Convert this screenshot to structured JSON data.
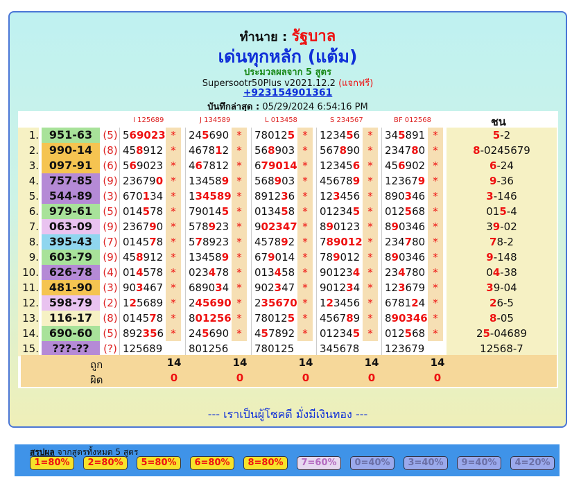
{
  "header": {
    "title_prefix": "ทำนาย :",
    "title_name": "รัฐบาล",
    "subtitle": "เด่นทุกหลัก (แต้ม)",
    "calc_text": "ประมวลผลจาก 5 สูตร",
    "version": "Supersootr50Plus v2021.12.2",
    "version_note": "(แจกฟรี)",
    "phone": "+923154901361",
    "saved_label": "บันทึกล่าสุด :",
    "saved_value": "05/29/2024 6:54:16 PM"
  },
  "columns": {
    "formula_headers": [
      "I 125689",
      "J 134589",
      "L 013458",
      "S 234567",
      "BF 012568"
    ],
    "chon_header": "ชน"
  },
  "rows": [
    {
      "idx": "1.",
      "code": "951-63",
      "bg": "#a8e29a",
      "count": "(5)",
      "nums": [
        [
          "5",
          "69023"
        ],
        [
          "24",
          "5",
          "690"
        ],
        [
          "78012",
          "5"
        ],
        [
          "1234",
          "5",
          "6"
        ],
        [
          "34",
          "5",
          "891"
        ]
      ],
      "chon": [
        [
          "5",
          true
        ],
        [
          "-2",
          false
        ]
      ]
    },
    {
      "idx": "2.",
      "code": "990-14",
      "bg": "#f5c451",
      "count": "(8)",
      "nums": [
        [
          "45",
          "8",
          "912"
        ],
        [
          "4678",
          "1",
          "2"
        ],
        [
          "56",
          "8",
          "903"
        ],
        [
          "567",
          "8",
          "90"
        ],
        [
          "2347",
          "8",
          "0"
        ]
      ],
      "chon": [
        [
          "8",
          true
        ],
        [
          "-0245679",
          false
        ]
      ]
    },
    {
      "idx": "3.",
      "code": "097-91",
      "bg": "#f5c451",
      "count": "(6)",
      "nums": [
        [
          "5",
          "6",
          "9023"
        ],
        [
          "4",
          "6",
          "7812"
        ],
        [
          "6",
          "79014"
        ],
        [
          "12345",
          "6"
        ],
        [
          "45",
          "6",
          "902"
        ]
      ],
      "chon": [
        [
          "6",
          true
        ],
        [
          "-24",
          false
        ]
      ]
    },
    {
      "idx": "4.",
      "code": "757-85",
      "bg": "#b58ad6",
      "count": "(9)",
      "nums": [
        [
          "23679",
          "0"
        ],
        [
          "13458",
          "9"
        ],
        [
          "568",
          "9",
          "03"
        ],
        [
          "45678",
          "9"
        ],
        [
          "12367",
          "9"
        ]
      ],
      "chon": [
        [
          "9",
          true
        ],
        [
          "-36",
          false
        ]
      ]
    },
    {
      "idx": "5.",
      "code": "544-89",
      "bg": "#b58ad6",
      "count": "(3)",
      "nums": [
        [
          "670",
          "1",
          "34"
        ],
        [
          "1",
          "34589"
        ],
        [
          "8912",
          "3",
          "6"
        ],
        [
          "12",
          "3",
          "456"
        ],
        [
          "890",
          "3",
          "46"
        ]
      ],
      "chon": [
        [
          "3",
          true
        ],
        [
          "-146",
          false
        ]
      ]
    },
    {
      "idx": "6.",
      "code": "979-61",
      "bg": "#a8e29a",
      "count": "(5)",
      "nums": [
        [
          "014",
          "5",
          "78"
        ],
        [
          "79014",
          "5"
        ],
        [
          "0134",
          "5",
          "8"
        ],
        [
          "01234",
          "5"
        ],
        [
          "012",
          "5",
          "68"
        ]
      ],
      "chon": [
        [
          "01",
          false
        ],
        [
          "5",
          true
        ],
        [
          "-4",
          false
        ]
      ]
    },
    {
      "idx": "7.",
      "code": "063-09",
      "bg": "#e9c3f0",
      "count": "(9)",
      "nums": [
        [
          "2367",
          "9",
          "0"
        ],
        [
          "578",
          "9",
          "23"
        ],
        [
          "9",
          "02347"
        ],
        [
          "8",
          "9",
          "0123"
        ],
        [
          "8",
          "9",
          "0346"
        ]
      ],
      "chon": [
        [
          "3",
          false
        ],
        [
          "9",
          true
        ],
        [
          "-02",
          false
        ]
      ]
    },
    {
      "idx": "8.",
      "code": "395-43",
      "bg": "#8fd6ef",
      "count": "(7)",
      "nums": [
        [
          "0145",
          "7",
          "8"
        ],
        [
          "5",
          "7",
          "8923"
        ],
        [
          "4578",
          "9",
          "2"
        ],
        [
          "7",
          "89012"
        ],
        [
          "234",
          "7",
          "80"
        ]
      ],
      "chon": [
        [
          "7",
          true
        ],
        [
          "8-2",
          false
        ]
      ]
    },
    {
      "idx": "9.",
      "code": "603-79",
      "bg": "#a8e29a",
      "count": "(9)",
      "nums": [
        [
          "45",
          "8",
          "912"
        ],
        [
          "13458",
          "9"
        ],
        [
          "67",
          "9",
          "014"
        ],
        [
          "78",
          "9",
          "012"
        ],
        [
          "8",
          "9",
          "0346"
        ]
      ],
      "chon": [
        [
          "9",
          true
        ],
        [
          "-148",
          false
        ]
      ]
    },
    {
      "idx": "10.",
      "code": "626-78",
      "bg": "#b58ad6",
      "count": "(4)",
      "nums": [
        [
          "01",
          "4",
          "578"
        ],
        [
          "023",
          "4",
          "78"
        ],
        [
          "013",
          "4",
          "58"
        ],
        [
          "90123",
          "4"
        ],
        [
          "23",
          "4",
          "780"
        ]
      ],
      "chon": [
        [
          "0",
          false
        ],
        [
          "4",
          true
        ],
        [
          "-38",
          false
        ]
      ]
    },
    {
      "idx": "11.",
      "code": "481-90",
      "bg": "#f5c451",
      "count": "(3)",
      "nums": [
        [
          "90",
          "3",
          "467"
        ],
        [
          "6890",
          "3",
          "4"
        ],
        [
          "902",
          "3",
          "47"
        ],
        [
          "9012",
          "3",
          "4"
        ],
        [
          "12",
          "3",
          "679"
        ]
      ],
      "chon": [
        [
          "3",
          true
        ],
        [
          "9-04",
          false
        ]
      ]
    },
    {
      "idx": "12.",
      "code": "598-79",
      "bg": "#e9c3f0",
      "count": "(2)",
      "nums": [
        [
          "1",
          "2",
          "5689"
        ],
        [
          "2",
          "45690"
        ],
        [
          "2",
          "35670"
        ],
        [
          "1",
          "2",
          "3456"
        ],
        [
          "6781",
          "2",
          "4"
        ]
      ],
      "chon": [
        [
          "2",
          true
        ],
        [
          "6-5",
          false
        ]
      ]
    },
    {
      "idx": "13.",
      "code": "116-17",
      "bg": "#f6f1c4",
      "count": "(8)",
      "nums": [
        [
          "0145",
          "7",
          "8"
        ],
        [
          "8",
          "01256"
        ],
        [
          "78012",
          "5"
        ],
        [
          "4567",
          "8",
          "9"
        ],
        [
          "8",
          "90346"
        ]
      ],
      "chon": [
        [
          "8",
          true
        ],
        [
          "-05",
          false
        ]
      ]
    },
    {
      "idx": "14.",
      "code": "690-60",
      "bg": "#a8e29a",
      "count": "(5)",
      "nums": [
        [
          "892",
          "35",
          "6"
        ],
        [
          "24",
          "5",
          "690"
        ],
        [
          "4",
          "5",
          "7892"
        ],
        [
          "01234",
          "5"
        ],
        [
          "012",
          "5",
          "68"
        ]
      ],
      "chon": [
        [
          "2",
          false
        ],
        [
          "5",
          true
        ],
        [
          "-04689",
          false
        ]
      ]
    },
    {
      "idx": "15.",
      "code": "???-??",
      "bg": "#b58ad6",
      "count": "(?)",
      "nums": [
        [
          "125689"
        ],
        [
          "801256"
        ],
        [
          "780125"
        ],
        [
          "345678"
        ],
        [
          "123679"
        ]
      ],
      "chon": [
        [
          "12568-7",
          false
        ]
      ]
    }
  ],
  "summary_row": {
    "hit_label": "ถูก",
    "miss_label": "ผิด",
    "hits": [
      "14",
      "14",
      "14",
      "14",
      "14"
    ],
    "misses": [
      "0",
      "0",
      "0",
      "0",
      "0"
    ]
  },
  "footer": {
    "message": "--- เราเป็นผู้โชคดี มั่งมีเงินทอง ---"
  },
  "summary": {
    "title": "สรุปผล",
    "subtitle": "จากสูตรทั้งหมด 5 สูตร",
    "badges": [
      {
        "label": "1=80%",
        "bg": "#f7e22a",
        "color": "#e11"
      },
      {
        "label": "2=80%",
        "bg": "#f7e22a",
        "color": "#e11"
      },
      {
        "label": "5=80%",
        "bg": "#f7e22a",
        "color": "#e11"
      },
      {
        "label": "6=80%",
        "bg": "#f7e22a",
        "color": "#e11"
      },
      {
        "label": "8=80%",
        "bg": "#f7e22a",
        "color": "#e11"
      },
      {
        "label": "7=60%",
        "bg": "#e6d8f0",
        "color": "#b46ac0"
      },
      {
        "label": "0=40%",
        "bg": "#9aa9ec",
        "color": "#6b6fa6"
      },
      {
        "label": "3=40%",
        "bg": "#9aa9ec",
        "color": "#6b6fa6"
      },
      {
        "label": "9=40%",
        "bg": "#9aa9ec",
        "color": "#6b6fa6"
      },
      {
        "label": "4=20%",
        "bg": "#9aa9ec",
        "color": "#6b6fa6"
      }
    ]
  }
}
